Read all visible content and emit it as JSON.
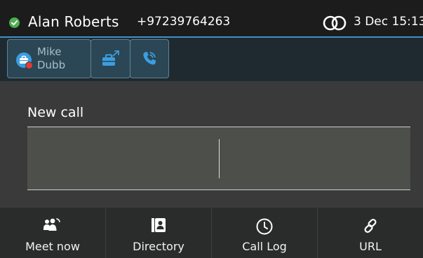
{
  "status_bar": {
    "user_name": "Alan Roberts",
    "phone_number": "+97239764263",
    "datetime": "3 Dec 15:13",
    "presence_icon": "available-check-icon",
    "dual_icon": "linked-circles-icon"
  },
  "quick_bar": {
    "contact": {
      "name_line1": "Mike",
      "name_line2": "Dubb",
      "presence": "busy"
    },
    "buttons": [
      {
        "icon": "transfer-briefcase-icon"
      },
      {
        "icon": "phone-call-icon"
      }
    ]
  },
  "main": {
    "label": "New call",
    "input_value": ""
  },
  "soft_keys": [
    {
      "label": "Meet now",
      "icon": "meet-now-icon"
    },
    {
      "label": "Directory",
      "icon": "directory-icon"
    },
    {
      "label": "Call Log",
      "icon": "clock-icon"
    },
    {
      "label": "URL",
      "icon": "link-icon"
    }
  ],
  "colors": {
    "accent": "#3f8fc7",
    "available": "#4caf50",
    "busy": "#e53935",
    "tile": "#2b4654"
  }
}
